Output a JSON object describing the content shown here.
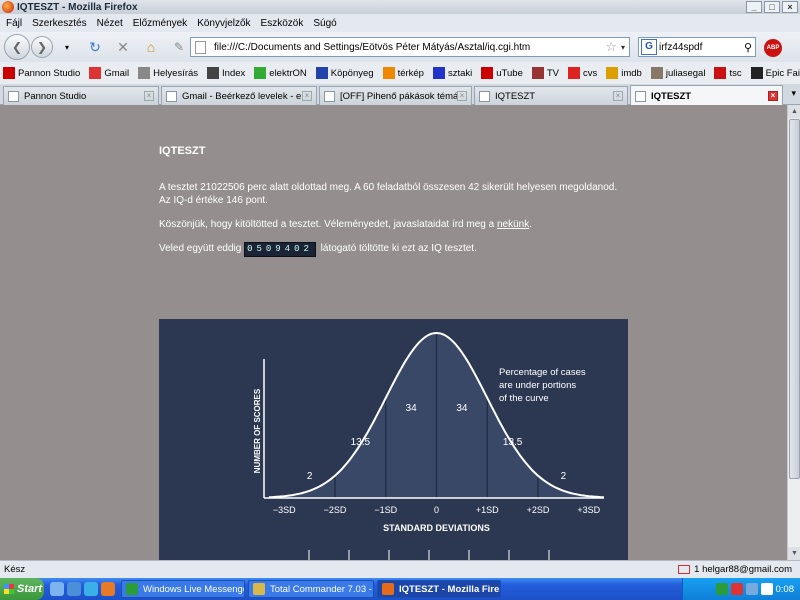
{
  "window": {
    "title": "IQTESZT - Mozilla Firefox"
  },
  "menu": [
    "Fájl",
    "Szerkesztés",
    "Nézet",
    "Előzmények",
    "Könyvjelzők",
    "Eszközök",
    "Súgó"
  ],
  "nav": {
    "url": "file:///C:/Documents and Settings/Eötvös Péter Mátyás/Asztal/iq.cgi.htm",
    "search_value": "irfz44spdf",
    "search_engine_letter": "G",
    "abp_label": "ABP"
  },
  "bookmarks": [
    {
      "label": "Pannon Studio",
      "icon": "youtube-icon",
      "color": "#c00"
    },
    {
      "label": "Gmail",
      "icon": "gmail-icon",
      "color": "#d33"
    },
    {
      "label": "Helyesírás",
      "icon": "page-icon",
      "color": "#888"
    },
    {
      "label": "Index",
      "icon": "index-icon",
      "color": "#444"
    },
    {
      "label": "elektrON",
      "icon": "electron-icon",
      "color": "#3a3"
    },
    {
      "label": "Köpönyeg",
      "icon": "weather-icon",
      "color": "#24a"
    },
    {
      "label": "térkép",
      "icon": "map-icon",
      "color": "#e80"
    },
    {
      "label": "sztaki",
      "icon": "sztaki-icon",
      "color": "#23c"
    },
    {
      "label": "uTube",
      "icon": "youtube-icon",
      "color": "#c00"
    },
    {
      "label": "TV",
      "icon": "tv-icon",
      "color": "#933"
    },
    {
      "label": "cvs",
      "icon": "cvs-icon",
      "color": "#d22"
    },
    {
      "label": "imdb",
      "icon": "imdb-icon",
      "color": "#dba000"
    },
    {
      "label": "juliasegal",
      "icon": "photo-icon",
      "color": "#876"
    },
    {
      "label": "tsc",
      "icon": "tsc-icon",
      "color": "#c11"
    },
    {
      "label": "Epic Fail",
      "icon": "fail-icon",
      "color": "#222"
    }
  ],
  "tabs": [
    {
      "label": "Pannon Studio",
      "active": false
    },
    {
      "label": "Gmail - Beérkező levelek - e...",
      "active": false
    },
    {
      "label": "[OFF] Pihenő pákások témáj...",
      "active": false
    },
    {
      "label": "IQTESZT",
      "active": false
    },
    {
      "label": "IQTESZT",
      "active": true
    }
  ],
  "page": {
    "heading": "IQTESZT",
    "result_line1": "A tesztet 21022506 perc alatt oldottad meg. A 60 feladatból összesen 42 sikerült helyesen megoldanod.",
    "result_line2": "Az IQ-d értéke 146 pont.",
    "thanks_prefix": "Köszönjük, hogy kitöltötted a tesztet. Véleményedet, javaslataidat írd meg a ",
    "thanks_link": "nekünk",
    "thanks_suffix": ".",
    "counter_prefix": "Veled együtt eddig ",
    "counter_value": "0509402",
    "counter_suffix": " látogató töltötte ki ezt az IQ tesztet."
  },
  "chart_data": {
    "type": "area",
    "title": "",
    "annotation": "Percentage of cases are under portions of the curve",
    "xlabel": "STANDARD DEVIATIONS",
    "ylabel": "NUMBER OF SCORES",
    "categories": [
      "−3SD",
      "−2SD",
      "−1SD",
      "0",
      "+1SD",
      "+2SD",
      "+3SD"
    ],
    "x": [
      -3,
      -2,
      -1,
      0,
      1,
      2,
      3
    ],
    "segments": [
      {
        "from": -3,
        "to": -2,
        "value": 2
      },
      {
        "from": -2,
        "to": -1,
        "value": 13.5
      },
      {
        "from": -1,
        "to": 0,
        "value": 34
      },
      {
        "from": 0,
        "to": 1,
        "value": 34
      },
      {
        "from": 1,
        "to": 2,
        "value": 13.5
      },
      {
        "from": 2,
        "to": 3,
        "value": 2
      }
    ],
    "xlim": [
      -3.3,
      3.3
    ],
    "colors": {
      "background": "#2c3752",
      "fill": "#3a4868",
      "curve": "#ffffff"
    }
  },
  "status": {
    "text": "Kész",
    "gmail": "1 helgar88@gmail.com"
  },
  "taskbar": {
    "start": "Start",
    "buttons": [
      {
        "label": "Windows Live Messenger",
        "active": false,
        "color": "#2a9d3a"
      },
      {
        "label": "Total Commander 7.03 - ...",
        "active": false,
        "color": "#d9b84a"
      },
      {
        "label": "IQTESZT - Mozilla Fire...",
        "active": true,
        "color": "#e66a1b"
      }
    ],
    "clock": "0:08"
  }
}
